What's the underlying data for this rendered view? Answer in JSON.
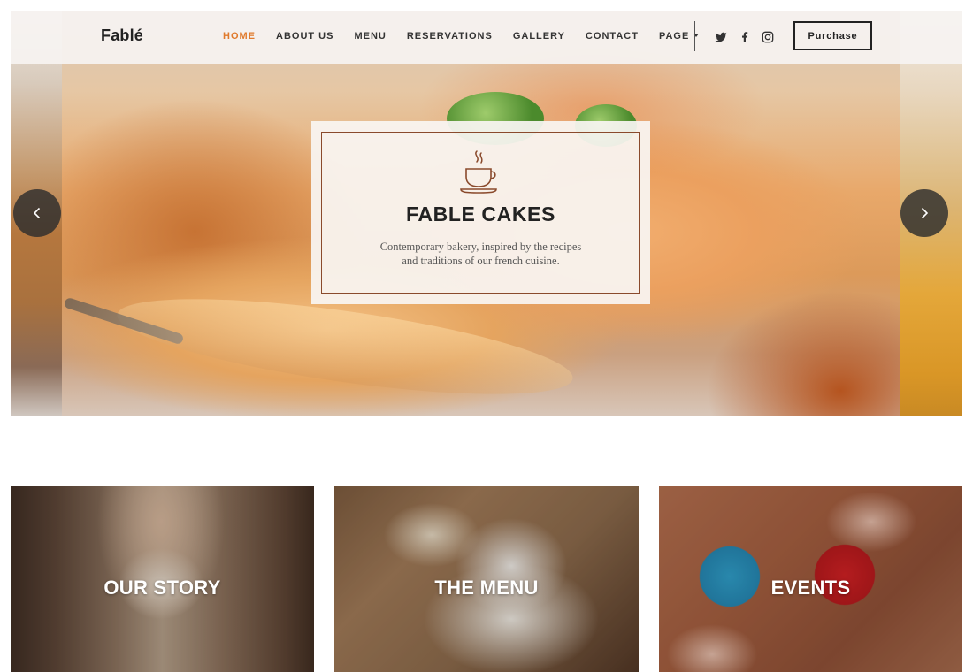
{
  "brand": {
    "logo": "Fablé"
  },
  "nav": {
    "items": [
      {
        "label": "HOME",
        "active": true
      },
      {
        "label": "ABOUT US",
        "active": false
      },
      {
        "label": "MENU",
        "active": false
      },
      {
        "label": "RESERVATIONS",
        "active": false
      },
      {
        "label": "GALLERY",
        "active": false
      },
      {
        "label": "CONTACT",
        "active": false
      },
      {
        "label": "PAGE",
        "active": false,
        "has_dropdown": true
      }
    ],
    "social": [
      "twitter-icon",
      "facebook-icon",
      "instagram-icon"
    ],
    "purchase_label": "Purchase"
  },
  "hero": {
    "title": "FABLE CAKES",
    "subtitle_line1": "Contemporary bakery, inspired by the recipes",
    "subtitle_line2": "and traditions of our french cuisine.",
    "icon": "coffee-cup-icon",
    "prev_icon": "chevron-left-icon",
    "next_icon": "chevron-right-icon"
  },
  "features": [
    {
      "label": "OUR STORY"
    },
    {
      "label": "THE MENU"
    },
    {
      "label": "EVENTS"
    }
  ],
  "colors": {
    "accent": "#e07a2c",
    "card_border": "#8a4a2c",
    "text_dark": "#222222"
  }
}
